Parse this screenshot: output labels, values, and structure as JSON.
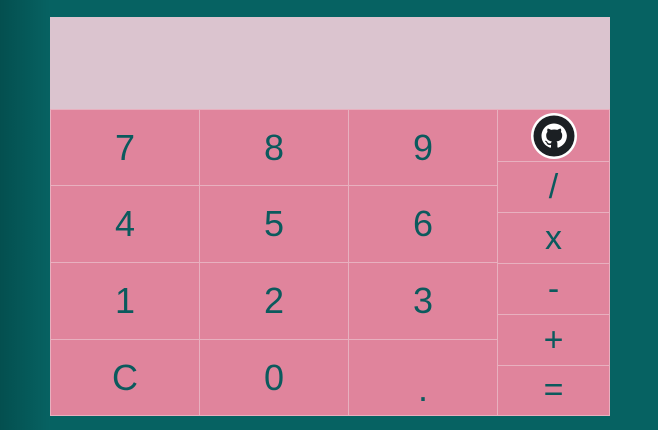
{
  "display": {
    "value": ""
  },
  "keys": {
    "seven": "7",
    "eight": "8",
    "nine": "9",
    "four": "4",
    "five": "5",
    "six": "6",
    "one": "1",
    "two": "2",
    "three": "3",
    "clear": "C",
    "zero": "0",
    "decimal": "."
  },
  "operators": {
    "divide": "/",
    "multiply": "x",
    "subtract": "-",
    "add": "+",
    "equals": "="
  },
  "icons": {
    "github": "github-icon"
  },
  "colors": {
    "background": "#066262",
    "display": "#dbc4cf",
    "keys": "#e0849c",
    "text": "#0b5a5d"
  }
}
